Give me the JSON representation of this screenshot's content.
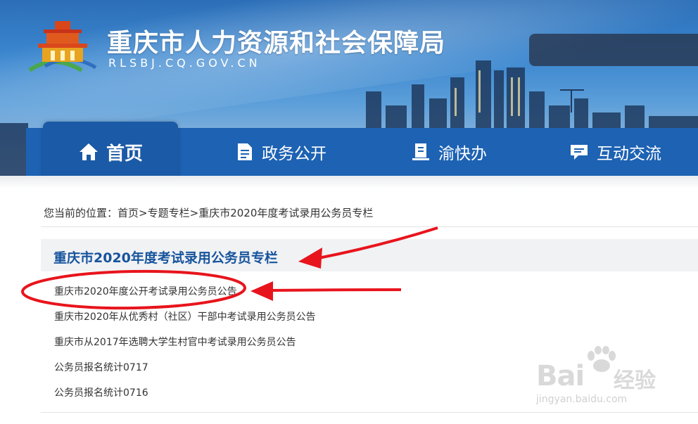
{
  "header": {
    "title": "重庆市人力资源和社会保障局",
    "domain": "RLSBJ.CQ.GOV.CN"
  },
  "nav": [
    {
      "label": "首页",
      "icon": "home-icon",
      "active": true
    },
    {
      "label": "政务公开",
      "icon": "document-icon"
    },
    {
      "label": "渝快办",
      "icon": "service-icon"
    },
    {
      "label": "互动交流",
      "icon": "chat-icon"
    }
  ],
  "breadcrumb": {
    "prefix": "您当前的位置：",
    "items": [
      "首页",
      "专题专栏",
      "重庆市2020年度考试录用公务员专栏"
    ],
    "separator": ">"
  },
  "section": {
    "title": "重庆市2020年度考试录用公务员专栏"
  },
  "articles": [
    "重庆市2020年度公开考试录用公务员公告",
    "重庆市2020年从优秀村（社区）干部中考试录用公务员公告",
    "重庆市从2017年选聘大学生村官中考试录用公务员公告",
    "公务员报名统计0717",
    "公务员报名统计0716"
  ],
  "watermark": {
    "brand": "Bai",
    "brand2": "经验",
    "url": "jingyan.baidu.com"
  },
  "colors": {
    "nav": "#1d62b3",
    "section_title": "#17549d",
    "annotation": "#e8141c"
  }
}
